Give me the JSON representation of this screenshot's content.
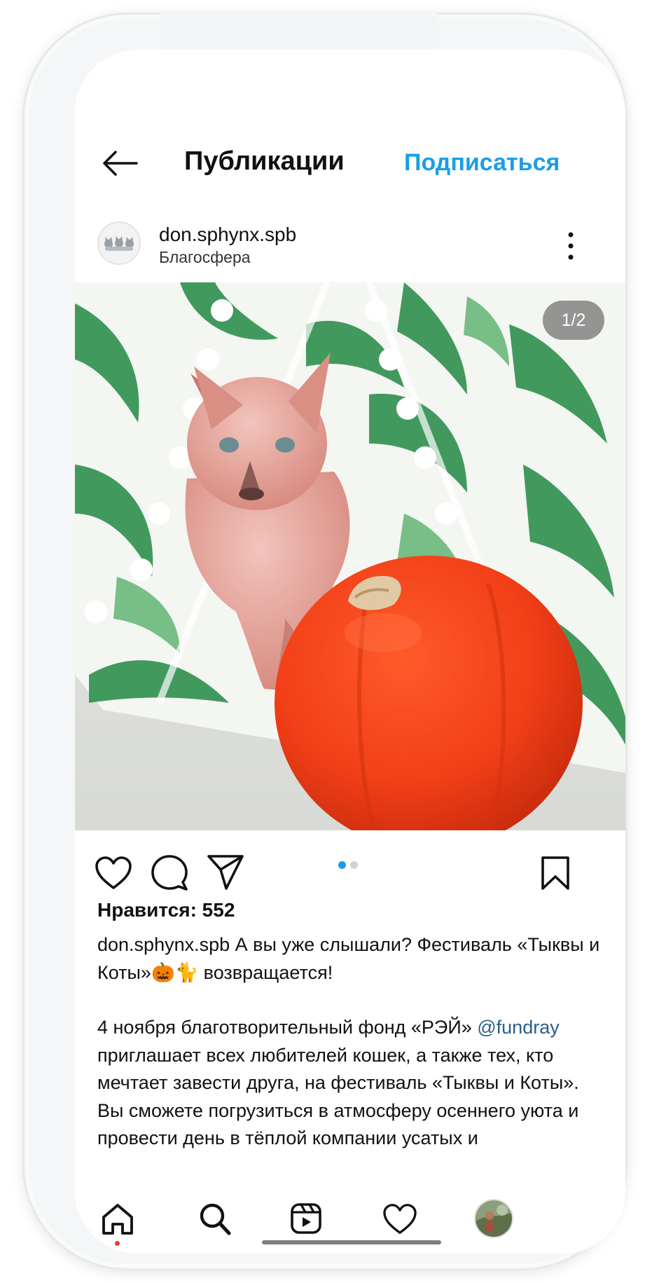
{
  "header": {
    "title": "Публикации",
    "follow_label": "Подписаться"
  },
  "post": {
    "username": "don.sphynx.spb",
    "location": "Благосфера",
    "image_counter": "1/2",
    "likes": "Нравится: 552",
    "caption_username": "don.sphynx.spb",
    "caption_line1": " А вы уже слышали? Фестиваль «Тыквы и Коты»🎃🐈 возвращается!",
    "caption_para2_start": "4 ноября благотворительный фонд «РЭЙ» ",
    "mention": "@fundray",
    "caption_para2_rest": " приглашает всех любителей кошек, а также тех, кто мечтает завести друга, на фестиваль «Тыквы и Коты». Вы сможете погрузиться в атмосферу осеннего уюта и провести день в тёплой компании усатых и"
  },
  "carousel": {
    "total": 2,
    "active": 1
  },
  "icons": {
    "back": "arrow-left-icon",
    "more": "more-vertical-icon",
    "like": "heart-icon",
    "comment": "comment-icon",
    "share": "send-icon",
    "save": "bookmark-icon",
    "nav": [
      "home-icon",
      "search-icon",
      "reels-icon",
      "activity-heart-icon",
      "profile-avatar"
    ]
  },
  "colors": {
    "accent": "#1a9ee8",
    "mention": "#2b5f86",
    "pumpkin": "#f0421c",
    "notification_dot": "#ee3b2f"
  }
}
